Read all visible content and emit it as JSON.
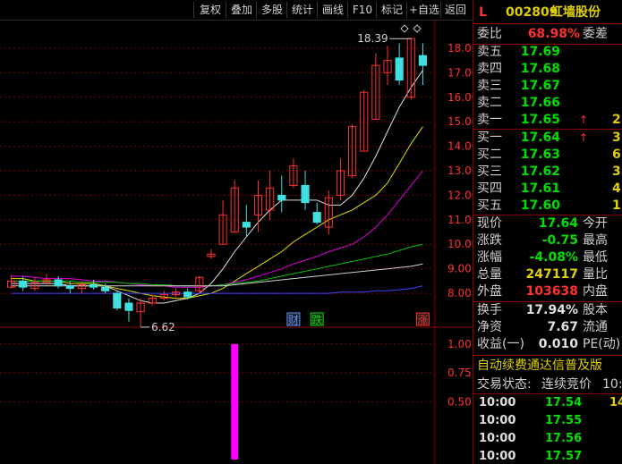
{
  "toolbar": {
    "buttons": [
      "复权",
      "叠加",
      "多股",
      "统计",
      "画线",
      "F10",
      "标记",
      "+自选",
      "返回"
    ]
  },
  "stock": {
    "flag": "L",
    "code": "002809",
    "name": "红墙股份"
  },
  "order_book": {
    "weibi_label": "委比",
    "weibi_value": "68.98%",
    "weicha_label": "委差",
    "sells": [
      {
        "label": "卖五",
        "price": "17.69"
      },
      {
        "label": "卖四",
        "price": "17.68"
      },
      {
        "label": "卖三",
        "price": "17.67"
      },
      {
        "label": "卖二",
        "price": "17.66"
      },
      {
        "label": "卖一",
        "price": "17.65",
        "arrow": "↑",
        "qty": "2"
      }
    ],
    "buys": [
      {
        "label": "买一",
        "price": "17.64",
        "arrow": "↑",
        "qty": "3"
      },
      {
        "label": "买二",
        "price": "17.63",
        "qty": "6"
      },
      {
        "label": "买三",
        "price": "17.62",
        "qty": "3"
      },
      {
        "label": "买四",
        "price": "17.61",
        "qty": "4"
      },
      {
        "label": "买五",
        "price": "17.60",
        "qty": "1"
      }
    ]
  },
  "quote": {
    "rows": [
      {
        "label": "现价",
        "value": "17.64",
        "color": "#00e000",
        "label2": "今开"
      },
      {
        "label": "涨跌",
        "value": "-0.75",
        "color": "#00e000",
        "label2": "最高"
      },
      {
        "label": "涨幅",
        "value": "-4.08%",
        "color": "#00e000",
        "label2": "最低"
      },
      {
        "label": "总量",
        "value": "247117",
        "color": "#e0d000",
        "label2": "量比"
      },
      {
        "label": "外盘",
        "value": "103638",
        "color": "#ff3030",
        "label2": "内盘"
      }
    ]
  },
  "stats": {
    "rows": [
      {
        "label": "换手",
        "value": "17.94%",
        "label2": "股本"
      },
      {
        "label": "净资",
        "value": "7.67",
        "label2": "流通"
      },
      {
        "label": "收益(一)",
        "value": "0.010",
        "label2": "PE(动)"
      }
    ]
  },
  "banner": {
    "text": "自动续费通达信普及版",
    "status_label": "交易状态:",
    "status_value": "连续竞价",
    "status_time": "10:0"
  },
  "ticks": [
    {
      "time": "10:00",
      "price": "17.54",
      "vol": "14"
    },
    {
      "time": "10:00",
      "price": "17.55"
    },
    {
      "time": "10:00",
      "price": "17.56"
    },
    {
      "time": "10:00",
      "price": "17.57"
    },
    {
      "time": "10:00",
      "price": "17.58"
    }
  ],
  "chart_data": [
    {
      "type": "candlestick",
      "y_ticks": [
        "18.00",
        "17.00",
        "16.00",
        "15.00",
        "14.00",
        "13.00",
        "12.00",
        "11.00",
        "10.00",
        "9.00",
        "8.00"
      ],
      "ylim": [
        7.2,
        18.8
      ],
      "annotations": {
        "high_label": "18.39",
        "low_label": "6.62"
      },
      "markers": [
        {
          "text": "财",
          "color": "#6090ff",
          "index": 24
        },
        {
          "text": "跌",
          "color": "#00e000",
          "index": 26
        },
        {
          "text": "涨",
          "color": "#ff3030",
          "index": 35
        }
      ],
      "candles": [
        [
          8.25,
          8.5,
          8.75,
          8.2
        ],
        [
          8.5,
          8.25,
          8.7,
          8.1
        ],
        [
          8.2,
          8.45,
          8.65,
          8.1
        ],
        [
          8.45,
          8.55,
          8.8,
          8.35
        ],
        [
          8.55,
          8.3,
          8.7,
          8.2
        ],
        [
          8.3,
          8.2,
          8.5,
          8.0
        ],
        [
          8.2,
          8.35,
          8.5,
          8.0
        ],
        [
          8.35,
          8.25,
          8.55,
          8.15
        ],
        [
          8.25,
          8.1,
          8.4,
          8.0
        ],
        [
          8.0,
          7.4,
          8.1,
          7.3
        ],
        [
          7.6,
          7.3,
          7.8,
          6.85
        ],
        [
          7.25,
          7.6,
          7.8,
          6.62
        ],
        [
          7.6,
          7.8,
          7.95,
          7.5
        ],
        [
          7.8,
          7.95,
          8.1,
          7.7
        ],
        [
          7.95,
          8.05,
          8.2,
          7.85
        ],
        [
          8.05,
          7.85,
          8.2,
          7.75
        ],
        [
          8.1,
          8.65,
          8.7,
          8.0
        ],
        [
          9.5,
          9.6,
          9.8,
          9.4
        ],
        [
          10.0,
          11.2,
          11.8,
          10.0
        ],
        [
          10.5,
          12.3,
          12.6,
          10.5
        ],
        [
          10.9,
          10.7,
          11.6,
          10.3
        ],
        [
          11.2,
          12.0,
          12.6,
          10.5
        ],
        [
          11.4,
          12.3,
          13.0,
          11.0
        ],
        [
          12.0,
          11.8,
          12.8,
          11.3
        ],
        [
          12.4,
          13.2,
          13.5,
          12.3
        ],
        [
          12.4,
          11.7,
          13.0,
          11.4
        ],
        [
          11.3,
          10.9,
          11.7,
          10.8
        ],
        [
          10.7,
          11.9,
          12.2,
          10.4
        ],
        [
          12.0,
          13.0,
          13.5,
          11.8
        ],
        [
          12.8,
          14.8,
          14.9,
          12.7
        ],
        [
          13.8,
          16.2,
          16.3,
          13.8
        ],
        [
          15.1,
          17.3,
          17.8,
          15.1
        ],
        [
          17.0,
          17.5,
          18.1,
          16.5
        ],
        [
          17.6,
          16.7,
          18.2,
          16.5
        ],
        [
          16.0,
          18.4,
          18.39,
          15.9
        ],
        [
          17.7,
          17.3,
          18.2,
          16.5
        ]
      ],
      "ma_lines": [
        {
          "color": "#e0e0e0",
          "values": [
            8.4,
            8.4,
            8.4,
            8.4,
            8.4,
            8.3,
            8.3,
            8.3,
            8.3,
            8.1,
            7.9,
            7.7,
            7.6,
            7.6,
            7.7,
            7.8,
            8.0,
            8.4,
            9.0,
            9.7,
            10.3,
            10.9,
            11.4,
            11.8,
            11.8,
            11.8,
            11.8,
            11.6,
            11.6,
            12.0,
            12.7,
            13.6,
            14.6,
            15.6,
            16.4,
            17.1
          ]
        },
        {
          "color": "#e0e000",
          "values": [
            8.6,
            8.6,
            8.5,
            8.5,
            8.5,
            8.4,
            8.4,
            8.4,
            8.3,
            8.2,
            8.1,
            8.0,
            7.9,
            7.85,
            7.8,
            7.8,
            7.9,
            8.0,
            8.2,
            8.5,
            8.8,
            9.1,
            9.4,
            9.7,
            10.1,
            10.4,
            10.7,
            11.0,
            11.2,
            11.4,
            11.7,
            12.0,
            12.5,
            13.3,
            14.1,
            14.8
          ]
        },
        {
          "color": "#e000e0",
          "values": [
            8.7,
            8.7,
            8.65,
            8.6,
            8.6,
            8.6,
            8.55,
            8.5,
            8.5,
            8.45,
            8.4,
            8.35,
            8.3,
            8.3,
            8.25,
            8.25,
            8.25,
            8.3,
            8.35,
            8.45,
            8.55,
            8.7,
            8.85,
            9.0,
            9.2,
            9.35,
            9.5,
            9.7,
            9.85,
            10.0,
            10.3,
            10.7,
            11.2,
            11.8,
            12.4,
            13.0
          ]
        },
        {
          "color": "#00c000",
          "values": [
            8.5,
            8.5,
            8.5,
            8.5,
            8.5,
            8.5,
            8.45,
            8.45,
            8.45,
            8.45,
            8.4,
            8.4,
            8.35,
            8.35,
            8.3,
            8.3,
            8.3,
            8.3,
            8.35,
            8.4,
            8.45,
            8.5,
            8.6,
            8.7,
            8.8,
            8.9,
            9.0,
            9.1,
            9.2,
            9.3,
            9.4,
            9.5,
            9.6,
            9.75,
            9.9,
            10.0
          ]
        },
        {
          "color": "#d0d0d0",
          "values": [
            8.3,
            8.3,
            8.3,
            8.3,
            8.3,
            8.3,
            8.3,
            8.3,
            8.3,
            8.3,
            8.3,
            8.3,
            8.3,
            8.3,
            8.3,
            8.3,
            8.3,
            8.3,
            8.3,
            8.35,
            8.4,
            8.45,
            8.5,
            8.55,
            8.6,
            8.65,
            8.7,
            8.75,
            8.8,
            8.85,
            8.9,
            8.95,
            9.0,
            9.05,
            9.1,
            9.2
          ]
        },
        {
          "color": "#4040ff",
          "values": [
            8.0,
            8.0,
            8.0,
            8.0,
            8.0,
            8.0,
            8.0,
            8.0,
            8.0,
            8.0,
            8.0,
            8.0,
            8.0,
            8.0,
            8.0,
            8.0,
            8.0,
            8.0,
            8.0,
            8.0,
            8.0,
            8.0,
            8.0,
            8.0,
            8.0,
            8.0,
            8.0,
            8.0,
            8.05,
            8.05,
            8.05,
            8.1,
            8.1,
            8.15,
            8.2,
            8.3
          ]
        }
      ]
    },
    {
      "type": "bar",
      "y_ticks": [
        "1.00",
        "0.75",
        "0.50"
      ],
      "ylim": [
        0,
        1.1
      ],
      "bars": [
        {
          "index": 19,
          "value": 1.0,
          "color": "#ff00ff"
        }
      ]
    }
  ]
}
